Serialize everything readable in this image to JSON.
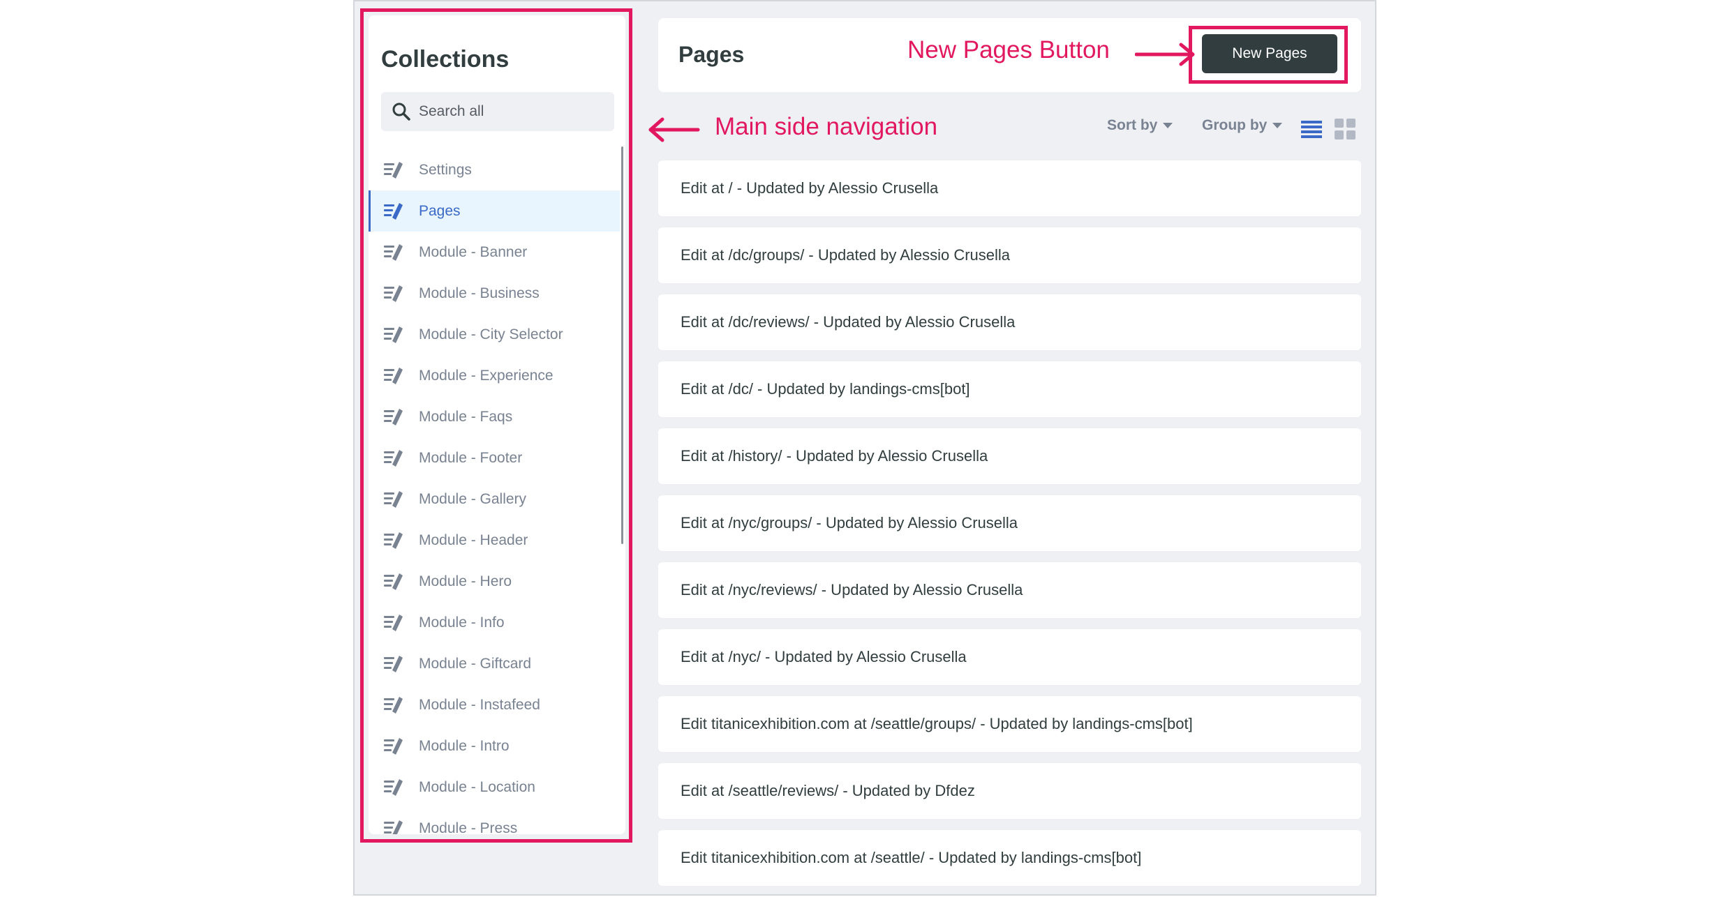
{
  "sidebar": {
    "title": "Collections",
    "search_placeholder": "Search all",
    "items": [
      {
        "label": "Settings"
      },
      {
        "label": "Pages",
        "active": true
      },
      {
        "label": "Module - Banner"
      },
      {
        "label": "Module - Business"
      },
      {
        "label": "Module - City Selector"
      },
      {
        "label": "Module - Experience"
      },
      {
        "label": "Module - Faqs"
      },
      {
        "label": "Module - Footer"
      },
      {
        "label": "Module - Gallery"
      },
      {
        "label": "Module - Header"
      },
      {
        "label": "Module - Hero"
      },
      {
        "label": "Module - Info"
      },
      {
        "label": "Module - Giftcard"
      },
      {
        "label": "Module - Instafeed"
      },
      {
        "label": "Module - Intro"
      },
      {
        "label": "Module - Location"
      },
      {
        "label": "Module - Press"
      }
    ]
  },
  "header": {
    "title": "Pages",
    "new_button_label": "New Pages"
  },
  "toolbar": {
    "sort_label": "Sort by",
    "group_label": "Group by"
  },
  "annotations": {
    "new_button_note": "New Pages Button",
    "sidebar_note": "Main side navigation",
    "color": "#e2185f"
  },
  "entries": [
    "Edit at / - Updated by Alessio Crusella",
    "Edit at /dc/groups/ - Updated by Alessio Crusella",
    "Edit at /dc/reviews/ - Updated by Alessio Crusella",
    "Edit at /dc/ - Updated by landings-cms[bot]",
    "Edit at /history/ - Updated by Alessio Crusella",
    "Edit at /nyc/groups/ - Updated by Alessio Crusella",
    "Edit at /nyc/reviews/ - Updated by Alessio Crusella",
    "Edit at /nyc/ - Updated by Alessio Crusella",
    "Edit titanicexhibition.com at /seattle/groups/ - Updated by landings-cms[bot]",
    "Edit at /seattle/reviews/ - Updated by Dfdez",
    "Edit titanicexhibition.com at /seattle/ - Updated by landings-cms[bot]"
  ]
}
